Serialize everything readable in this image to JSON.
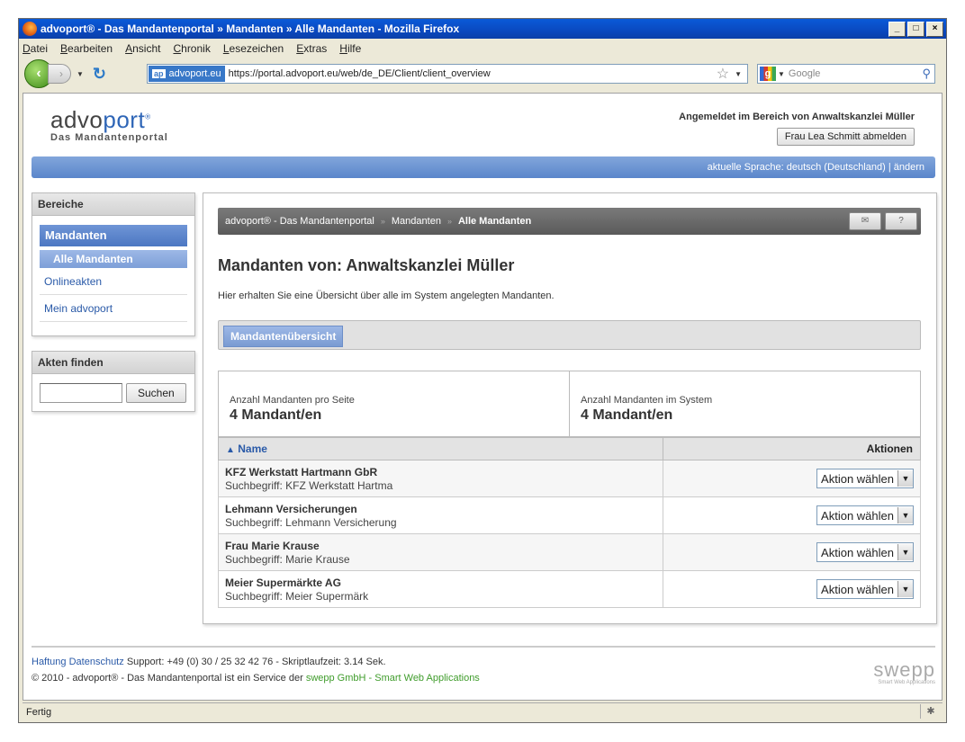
{
  "browser": {
    "title": "advoport® - Das Mandantenportal » Mandanten » Alle Mandanten - Mozilla Firefox",
    "menu": [
      "Datei",
      "Bearbeiten",
      "Ansicht",
      "Chronik",
      "Lesezeichen",
      "Extras",
      "Hilfe"
    ],
    "site_badge": "advoport.eu",
    "site_badge_short": "ap",
    "url": "https://portal.advoport.eu/web/de_DE/Client/client_overview",
    "search_placeholder": "Google",
    "status": "Fertig"
  },
  "header": {
    "logo_a": "advo",
    "logo_b": "port",
    "logo_reg": "®",
    "logo_sub": "Das Mandantenportal",
    "login_text": "Angemeldet im Bereich von Anwaltskanzlei Müller",
    "logout_button": "Frau Lea Schmitt abmelden",
    "language_bar": "aktuelle Sprache: deutsch (Deutschland) | ändern"
  },
  "sidebar": {
    "areas_title": "Bereiche",
    "main_item": "Mandanten",
    "sub_item": "Alle Mandanten",
    "links": [
      "Onlineakten",
      "Mein advoport"
    ],
    "find_title": "Akten finden",
    "find_button": "Suchen"
  },
  "main": {
    "breadcrumb": [
      "advoport® - Das Mandantenportal",
      "Mandanten",
      "Alle Mandanten"
    ],
    "heading": "Mandanten von: Anwaltskanzlei Müller",
    "intro": "Hier erhalten Sie eine Übersicht über alle im System angelegten Mandanten.",
    "tab": "Mandantenübersicht",
    "stats": [
      {
        "label": "Anzahl Mandanten pro Seite",
        "value": "4 Mandant/en"
      },
      {
        "label": "Anzahl Mandanten im System",
        "value": "4 Mandant/en"
      }
    ],
    "table": {
      "sort_indicator": "▲",
      "col_name": "Name",
      "col_actions": "Aktionen",
      "rows": [
        {
          "name": "KFZ Werkstatt Hartmann GbR",
          "search": "Suchbegriff: KFZ Werkstatt Hartma",
          "action": "Aktion wählen"
        },
        {
          "name": "Lehmann Versicherungen",
          "search": "Suchbegriff: Lehmann Versicherung",
          "action": "Aktion wählen"
        },
        {
          "name": "Frau Marie Krause",
          "search": "Suchbegriff: Marie Krause",
          "action": "Aktion wählen"
        },
        {
          "name": "Meier Supermärkte AG",
          "search": "Suchbegriff: Meier Supermärk",
          "action": "Aktion wählen"
        }
      ]
    }
  },
  "footer": {
    "link_liability": "Haftung",
    "link_privacy": "Datenschutz",
    "support": "Support: +49 (0) 30 / 25 32 42 76 - Skriptlaufzeit: 3.14 Sek.",
    "copyright": "© 2010 - advoport® - Das Mandantenportal ist ein Service der",
    "company": "swepp GmbH - Smart Web Applications",
    "logo": "swepp",
    "logo_tagline": "Smart Web Applications"
  }
}
